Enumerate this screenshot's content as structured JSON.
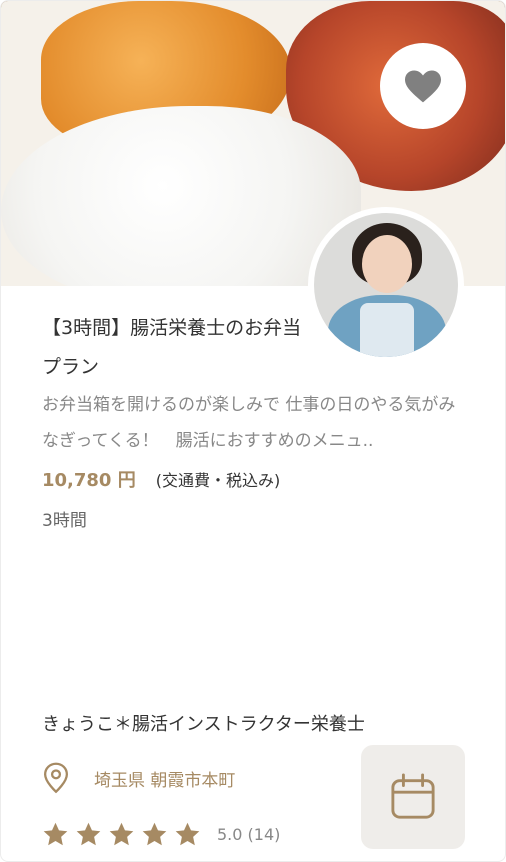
{
  "plan": {
    "title": "【3時間】腸活栄養士のお弁当プラン",
    "description": "お弁当箱を開けるのが楽しみで 仕事の日のやる気がみなぎってくる！　腸活におすすめのメニュ..",
    "price": "10,780 円",
    "tax_note": "(交通費・税込み)",
    "duration": "3時間"
  },
  "instructor": {
    "name": "きょうこ＊腸活インストラクター栄養士",
    "location": "埼玉県 朝霞市本町"
  },
  "rating": {
    "stars": 5,
    "value_text": "5.0 (14)"
  },
  "icons": {
    "favorite": "heart-icon",
    "location": "location-pin-icon",
    "calendar": "calendar-icon",
    "star": "star-icon"
  },
  "colors": {
    "accent": "#a68a63",
    "icon_gray": "#808080",
    "text": "#333333",
    "muted": "#888888"
  }
}
